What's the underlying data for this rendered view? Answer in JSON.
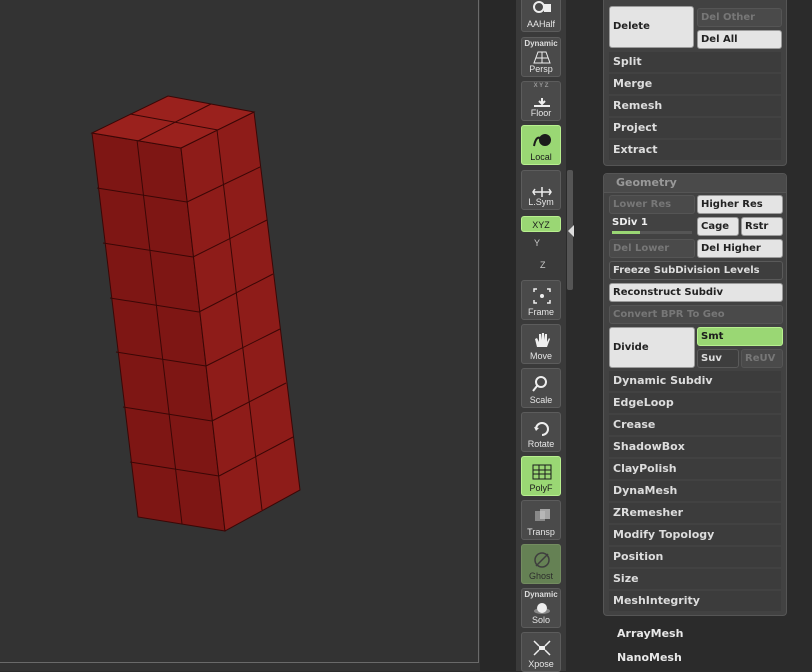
{
  "shelf": {
    "aahalf": "AAHalf",
    "persp_top": "Dynamic",
    "persp": "Persp",
    "floor_top": "X Y Z",
    "floor": "Floor",
    "local": "Local",
    "lsym": "L.Sym",
    "xyz": "XYZ",
    "y": "Y",
    "z": "Z",
    "frame": "Frame",
    "move": "Move",
    "scale": "Scale",
    "rotate": "Rotate",
    "polyf": "PolyF",
    "transp": "Transp",
    "ghost": "Ghost",
    "solo_top": "Dynamic",
    "solo": "Solo",
    "xpose": "Xpose"
  },
  "subtool": {
    "delete": "Delete",
    "del_other": "Del Other",
    "del_all": "Del All",
    "items": [
      "Split",
      "Merge",
      "Remesh",
      "Project",
      "Extract"
    ]
  },
  "geometry": {
    "title": "Geometry",
    "lower_res": "Lower Res",
    "higher_res": "Higher Res",
    "sdiv": "SDiv 1",
    "sdiv_fraction": 0.35,
    "cage": "Cage",
    "rstr": "Rstr",
    "del_lower": "Del Lower",
    "del_higher": "Del Higher",
    "freeze": "Freeze SubDivision Levels",
    "reconstruct": "Reconstruct Subdiv",
    "convert_bpr": "Convert BPR To Geo",
    "divide": "Divide",
    "smt": "Smt",
    "suv": "Suv",
    "reuv": "ReUV",
    "items": [
      "Dynamic Subdiv",
      "EdgeLoop",
      "Crease",
      "ShadowBox",
      "ClayPolish",
      "DynaMesh",
      "ZRemesher",
      "Modify Topology",
      "Position",
      "Size",
      "MeshIntegrity"
    ]
  },
  "menus": {
    "arraymesh": "ArrayMesh",
    "nanomesh": "NanoMesh"
  },
  "colors": {
    "accent_green": "#9ad774",
    "mesh_red": "#8a1a17"
  }
}
